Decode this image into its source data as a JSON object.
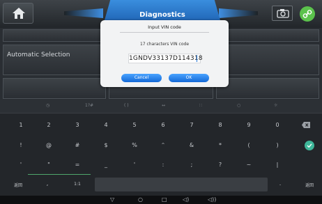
{
  "header": {
    "title": "Diagnostics",
    "icons": [
      "home-icon",
      "camera-icon",
      "link-icon"
    ]
  },
  "main": {
    "automatic_selection_label": "Automatic Selection"
  },
  "dialog": {
    "title": "Input VIN code",
    "caption": "17 characters VIN code",
    "vin_value": "1GNDV33137D114318",
    "cancel_label": "Cancel",
    "ok_label": "OK"
  },
  "keyboard": {
    "top_row": [
      "◷",
      "1?#",
      "( )",
      "↔",
      "∷",
      "○",
      "☼"
    ],
    "row_numbers": [
      "1",
      "2",
      "3",
      "4",
      "5",
      "6",
      "7",
      "8",
      "9",
      "0"
    ],
    "row_symbols1": [
      "!",
      "@",
      "#",
      "$",
      "%",
      "^",
      "&",
      "*",
      "(",
      ")"
    ],
    "row_symbols2": [
      "'",
      "\"",
      "=",
      "_",
      "'",
      ":",
      ";",
      "?",
      "~",
      "|"
    ],
    "bottom": {
      "left_label": "返回",
      "comma": ",",
      "switch": "1:1",
      "period": ".",
      "right_label": "返回"
    },
    "accent_color": "#3fb79a"
  },
  "navbar": {
    "icons": [
      "▽",
      "○",
      "□",
      "◁)",
      "◁))"
    ]
  }
}
